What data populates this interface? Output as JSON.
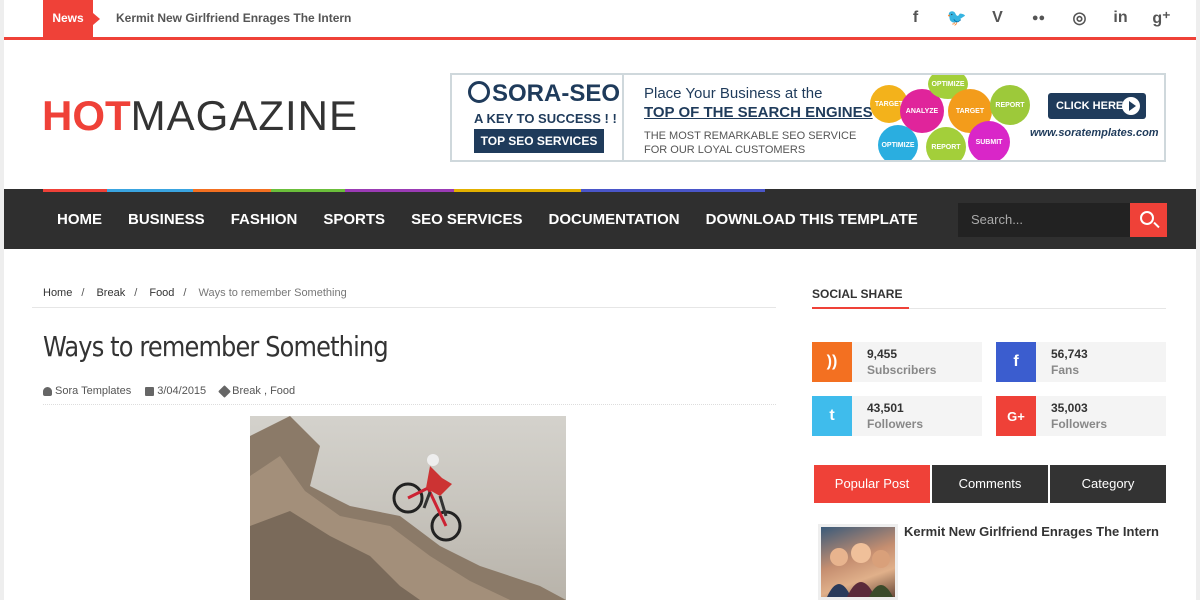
{
  "topbar": {
    "news_label": "News",
    "ticker": "Kermit New Girlfriend Enrages The Intern",
    "social": [
      {
        "icon": "facebook-icon",
        "glyph": "f"
      },
      {
        "icon": "twitter-icon",
        "glyph": "🐦"
      },
      {
        "icon": "vimeo-icon",
        "glyph": "V"
      },
      {
        "icon": "flickr-icon",
        "glyph": "●●"
      },
      {
        "icon": "dribbble-icon",
        "glyph": "◎"
      },
      {
        "icon": "linkedin-icon",
        "glyph": "in"
      },
      {
        "icon": "google-plus-icon",
        "glyph": "g⁺"
      }
    ]
  },
  "logo": {
    "hot": "HOT",
    "magazine": "MAGAZINE"
  },
  "banner": {
    "brand": "SORA-SEO",
    "key": "A KEY TO SUCCESS ! !",
    "top_services": "TOP SEO SERVICES",
    "line1": "Place Your Business at the",
    "line2": "TOP OF THE SEARCH ENGINES",
    "line3": "THE MOST REMARKABLE SEO SERVICE FOR OUR LOYAL CUSTOMERS",
    "click": "CLICK HERE",
    "url": "www.soratemplates.com",
    "bubbles": [
      "TARGET",
      "ANALYZE",
      "OPTIMIZE",
      "TARGET",
      "REPORT",
      "OPTIMIZE",
      "REPORT",
      "SUBMIT"
    ]
  },
  "nav": {
    "colors": [
      "#ef4138",
      "#3aa4e0",
      "#f37021",
      "#6bbf3b",
      "#9b3bb5",
      "#e2b000",
      "#4a56c9"
    ],
    "items": [
      "HOME",
      "BUSINESS",
      "FASHION",
      "SPORTS",
      "SEO SERVICES",
      "DOCUMENTATION",
      "DOWNLOAD THIS TEMPLATE"
    ],
    "search_placeholder": "Search..."
  },
  "breadcrumb": {
    "items": [
      "Home",
      "Break",
      "Food"
    ],
    "current": "Ways to remember Something"
  },
  "post": {
    "title": "Ways to remember Something",
    "author": "Sora Templates",
    "date": "3/04/2015",
    "labels": "Break , Food"
  },
  "sidebar": {
    "social_share_title": "SOCIAL SHARE",
    "counters": [
      {
        "icon": "rss-icon",
        "glyph": "))",
        "count": "9,455",
        "label": "Subscribers",
        "color": "#f37021"
      },
      {
        "icon": "facebook-icon",
        "glyph": "f",
        "count": "56,743",
        "label": "Fans",
        "color": "#3b5dcf"
      },
      {
        "icon": "twitter-icon",
        "glyph": "t",
        "count": "43,501",
        "label": "Followers",
        "color": "#3fbcec"
      },
      {
        "icon": "google-plus-icon",
        "glyph": "G+",
        "count": "35,003",
        "label": "Followers",
        "color": "#ef4138"
      }
    ],
    "tabs": [
      "Popular Post",
      "Comments",
      "Category"
    ],
    "popular_post_title": "Kermit New Girlfriend Enrages The Intern"
  },
  "colors": {
    "accent": "#ef4138",
    "nav_bg": "#2f2f2f"
  }
}
